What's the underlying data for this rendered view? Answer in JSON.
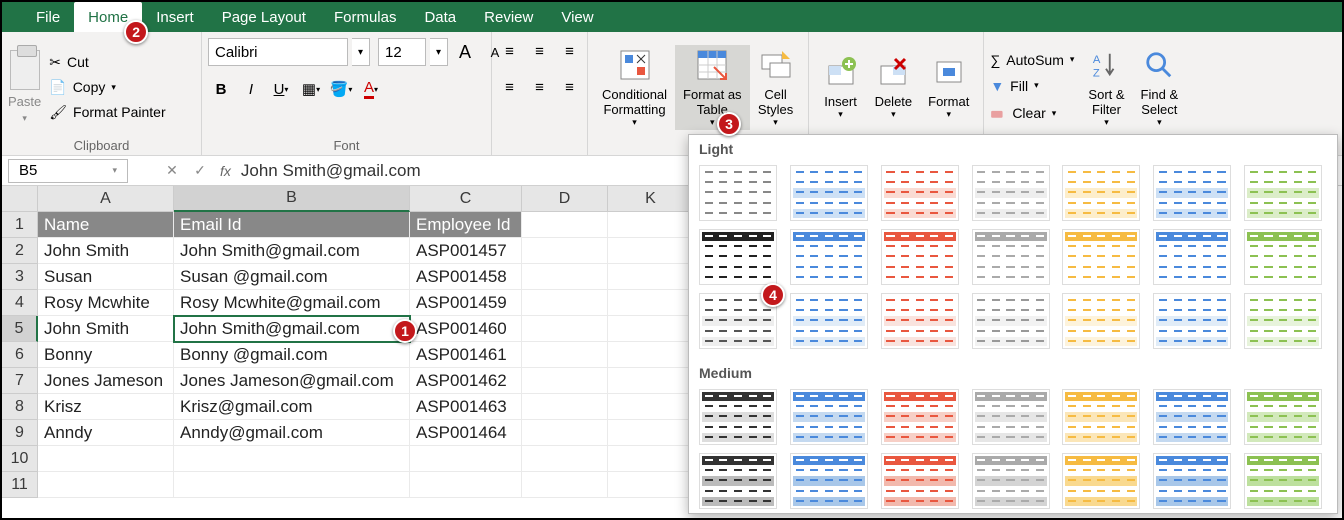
{
  "menubar": {
    "file": "File",
    "home": "Home",
    "insert": "Insert",
    "pagelayout": "Page Layout",
    "formulas": "Formulas",
    "data": "Data",
    "review": "Review",
    "view": "View"
  },
  "steps": {
    "2": "2",
    "1": "1",
    "3": "3",
    "4": "4"
  },
  "ribbon": {
    "paste": "Paste",
    "cut": "Cut",
    "copy": "Copy",
    "fmtpaint": "Format Painter",
    "clipboard_label": "Clipboard",
    "font_name": "Calibri",
    "font_size": "12",
    "font_label": "Font",
    "cond_fmt": "Conditional\nFormatting",
    "fmt_table": "Format as\nTable",
    "cell_styles": "Cell\nStyles",
    "insert": "Insert",
    "delete": "Delete",
    "format": "Format",
    "autosum": "AutoSum",
    "fill": "Fill",
    "clear": "Clear",
    "sort_filter": "Sort &\nFilter",
    "find_select": "Find &\nSelect"
  },
  "styles_popup": {
    "light": "Light",
    "medium": "Medium"
  },
  "fbar": {
    "name": "B5",
    "value": "John Smith@gmail.com"
  },
  "columns": [
    "A",
    "B",
    "C",
    "D",
    "K"
  ],
  "rows": [
    "1",
    "2",
    "3",
    "4",
    "5",
    "6",
    "7",
    "8",
    "9",
    "10",
    "11"
  ],
  "headers": {
    "A": "Name",
    "B": "Email Id",
    "C": "Employee Id"
  },
  "data": [
    {
      "A": "John Smith",
      "B": "John Smith@gmail.com",
      "C": "ASP001457"
    },
    {
      "A": "Susan",
      "B": "Susan @gmail.com",
      "C": "ASP001458"
    },
    {
      "A": "Rosy Mcwhite",
      "B": "Rosy Mcwhite@gmail.com",
      "C": "ASP001459"
    },
    {
      "A": "John Smith",
      "B": "John Smith@gmail.com",
      "C": "ASP001460"
    },
    {
      "A": "Bonny",
      "B": "Bonny @gmail.com",
      "C": "ASP001461"
    },
    {
      "A": "Jones Jameson",
      "B": "Jones Jameson@gmail.com",
      "C": "ASP001462"
    },
    {
      "A": "Krisz",
      "B": "Krisz@gmail.com",
      "C": "ASP001463"
    },
    {
      "A": "Anndy",
      "B": "Anndy@gmail.com",
      "C": "ASP001464"
    }
  ],
  "light_thumbs": [
    [
      "#888",
      "transparent"
    ],
    [
      "#4a89dc",
      "#cde0f5"
    ],
    [
      "#e9573f",
      "#fadbd3"
    ],
    [
      "#aaa",
      "#eee"
    ],
    [
      "#f6bb42",
      "#fdeecb"
    ],
    [
      "#4a89dc",
      "#cde0f5"
    ],
    [
      "#8cc152",
      "#dbedc8"
    ],
    [
      "#222",
      "transparent"
    ],
    [
      "#4a89dc",
      "transparent"
    ],
    [
      "#e9573f",
      "transparent"
    ],
    [
      "#aaa",
      "transparent"
    ],
    [
      "#f6bb42",
      "transparent"
    ],
    [
      "#4a89dc",
      "transparent"
    ],
    [
      "#8cc152",
      "transparent"
    ],
    [
      "#555",
      "#eee"
    ],
    [
      "#4a89dc",
      "#e1ecf7"
    ],
    [
      "#e9573f",
      "#f9e3de"
    ],
    [
      "#999",
      "#f2f2f2"
    ],
    [
      "#f6bb42",
      "#fdf3dc"
    ],
    [
      "#4a89dc",
      "#e1ecf7"
    ],
    [
      "#8cc152",
      "#e7f3db"
    ]
  ],
  "medium_thumbs": [
    [
      "#333",
      "#ddd"
    ],
    [
      "#4a89dc",
      "#c4d9f0"
    ],
    [
      "#e9573f",
      "#f7cfc6"
    ],
    [
      "#aaa",
      "#e6e6e6"
    ],
    [
      "#f6bb42",
      "#fbe6b8"
    ],
    [
      "#4a89dc",
      "#c4d9f0"
    ],
    [
      "#8cc152",
      "#d2e9bb"
    ],
    [
      "#333",
      "#bbb"
    ],
    [
      "#4a89dc",
      "#a8c7e9"
    ],
    [
      "#e9573f",
      "#f2b9ad"
    ],
    [
      "#aaa",
      "#d4d4d4"
    ],
    [
      "#f6bb42",
      "#f9d98f"
    ],
    [
      "#4a89dc",
      "#a8c7e9"
    ],
    [
      "#8cc152",
      "#bde09e"
    ]
  ]
}
